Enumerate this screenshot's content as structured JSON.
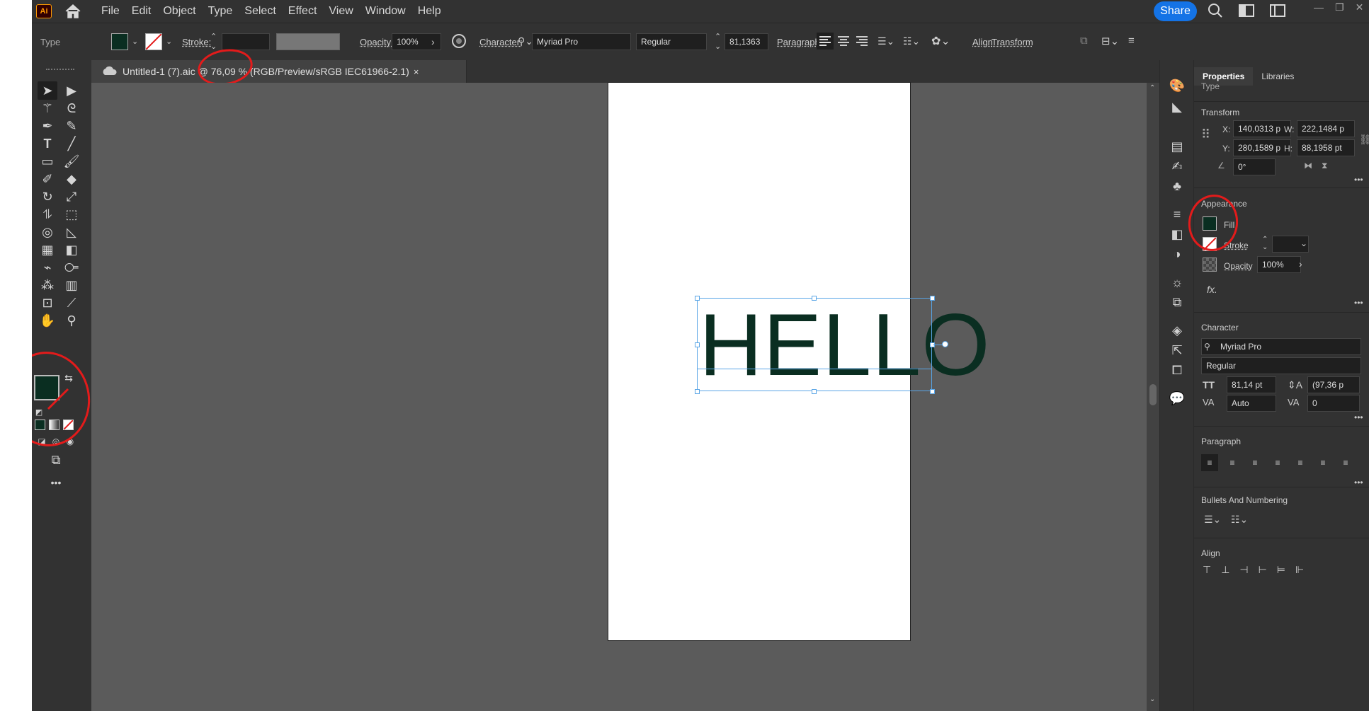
{
  "app": {
    "logo": "Ai"
  },
  "menu": [
    "File",
    "Edit",
    "Object",
    "Type",
    "Select",
    "Effect",
    "View",
    "Window",
    "Help"
  ],
  "menubar": {
    "share": "Share"
  },
  "control": {
    "mode": "Type",
    "stroke_label": "Stroke:",
    "opacity_label": "Opacity:",
    "opacity_value": "100%",
    "character_label": "Character:",
    "font": "Myriad Pro",
    "style": "Regular",
    "size": "81,1363",
    "paragraph_label": "Paragraph:",
    "align_label": "Align",
    "transform_label": "Transform"
  },
  "document": {
    "tab_title": "Untitled-1 (7).aic @ 76,09 % (RGB/Preview/sRGB IEC61966-2.1)",
    "close": "×"
  },
  "canvas": {
    "text": "HELLO"
  },
  "colors": {
    "fill": "#0a2e21",
    "selection": "#59a5e6",
    "annotation": "#e31b1b"
  },
  "panel": {
    "tabs": [
      "Properties",
      "Libraries"
    ],
    "type_heading": "Type",
    "transform_heading": "Transform",
    "x_label": "X:",
    "x_value": "140,0313 p",
    "y_label": "Y:",
    "y_value": "280,1589 p",
    "w_label": "W:",
    "w_value": "222,1484 p",
    "h_label": "H:",
    "h_value": "88,1958 pt",
    "angle_value": "0°",
    "appearance_heading": "Appearance",
    "fill_label": "Fill",
    "stroke_label": "Stroke",
    "opacity_label": "Opacity",
    "opacity_value": "100%",
    "fx_label": "fx.",
    "character_heading": "Character",
    "font": "Myriad Pro",
    "style": "Regular",
    "font_size": "81,14 pt",
    "leading": "(97,36 p",
    "kerning": "Auto",
    "tracking": "0",
    "paragraph_heading": "Paragraph",
    "bullets_heading": "Bullets And Numbering",
    "align_heading": "Align"
  }
}
